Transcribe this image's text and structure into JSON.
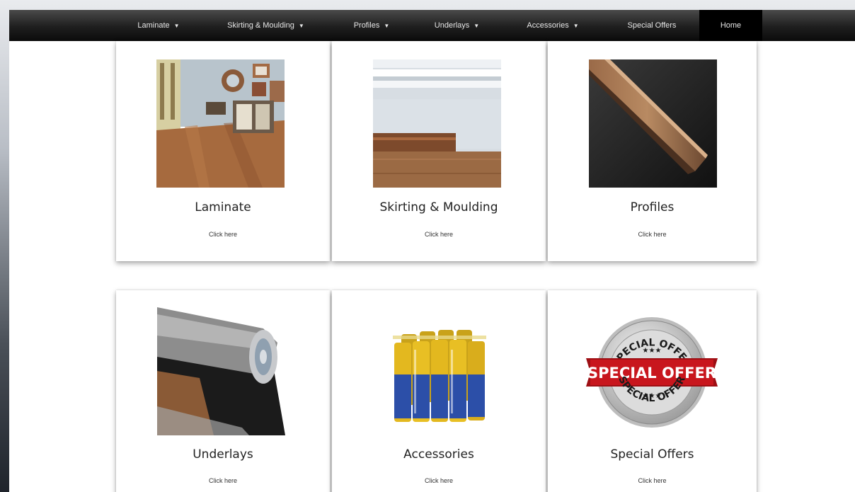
{
  "nav": {
    "items": [
      {
        "label": "Laminate",
        "caret": "▼"
      },
      {
        "label": "Skirting & Moulding",
        "caret": "▼"
      },
      {
        "label": "Profiles",
        "caret": "▼"
      },
      {
        "label": "Underlays",
        "caret": "▼"
      },
      {
        "label": "Accessories",
        "caret": "▼"
      },
      {
        "label": "Special Offers",
        "caret": ""
      },
      {
        "label": "Home",
        "caret": ""
      }
    ]
  },
  "cards": [
    {
      "title": "Laminate",
      "link": "Click here"
    },
    {
      "title": "Skirting & Moulding",
      "link": "Click here"
    },
    {
      "title": "Profiles",
      "link": "Click here"
    },
    {
      "title": "Underlays",
      "link": "Click here"
    },
    {
      "title": "Accessories",
      "link": "Click here"
    },
    {
      "title": "Special Offers",
      "link": "Click here"
    }
  ],
  "badge": {
    "arc_top": "SPECIAL OFFER",
    "ribbon": "SPECIAL OFFER",
    "arc_bottom": "SPECIAL OFFER",
    "stars": "★★★"
  },
  "colors": {
    "nav_bg": "#1e1e1e",
    "active": "#000000",
    "ribbon_red": "#c8161d"
  }
}
